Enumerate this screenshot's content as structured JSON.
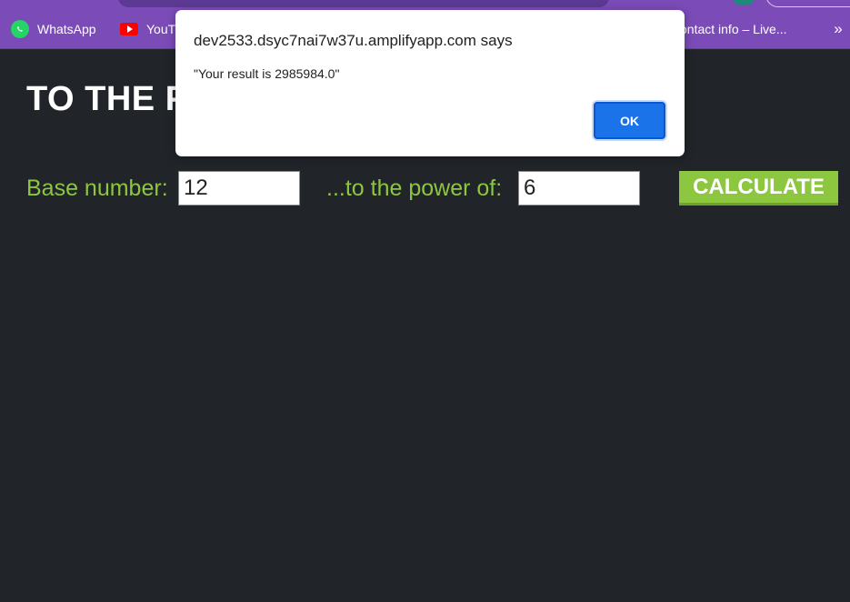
{
  "bookmarks": [
    {
      "label": "WhatsApp",
      "icon": "whatsapp-icon"
    },
    {
      "label": "YouT",
      "icon": "youtube-icon"
    },
    {
      "label": "ontact info – Live..."
    }
  ],
  "bookmarks_more": "»",
  "page": {
    "title": "TO THE P",
    "base_label": "Base number:",
    "base_value": "12",
    "power_label": "...to the power of:",
    "power_value": "6",
    "calculate_label": "CALCULATE"
  },
  "dialog": {
    "origin": "dev2533.dsyc7nai7w37u.amplifyapp.com says",
    "message": "\"Your result is 2985984.0\"",
    "ok_label": "OK"
  },
  "colors": {
    "page_background": "#212529",
    "accent_green": "#8dc63f",
    "browser_purple": "#7b4cb8",
    "dialog_button_blue": "#1a73e8"
  }
}
